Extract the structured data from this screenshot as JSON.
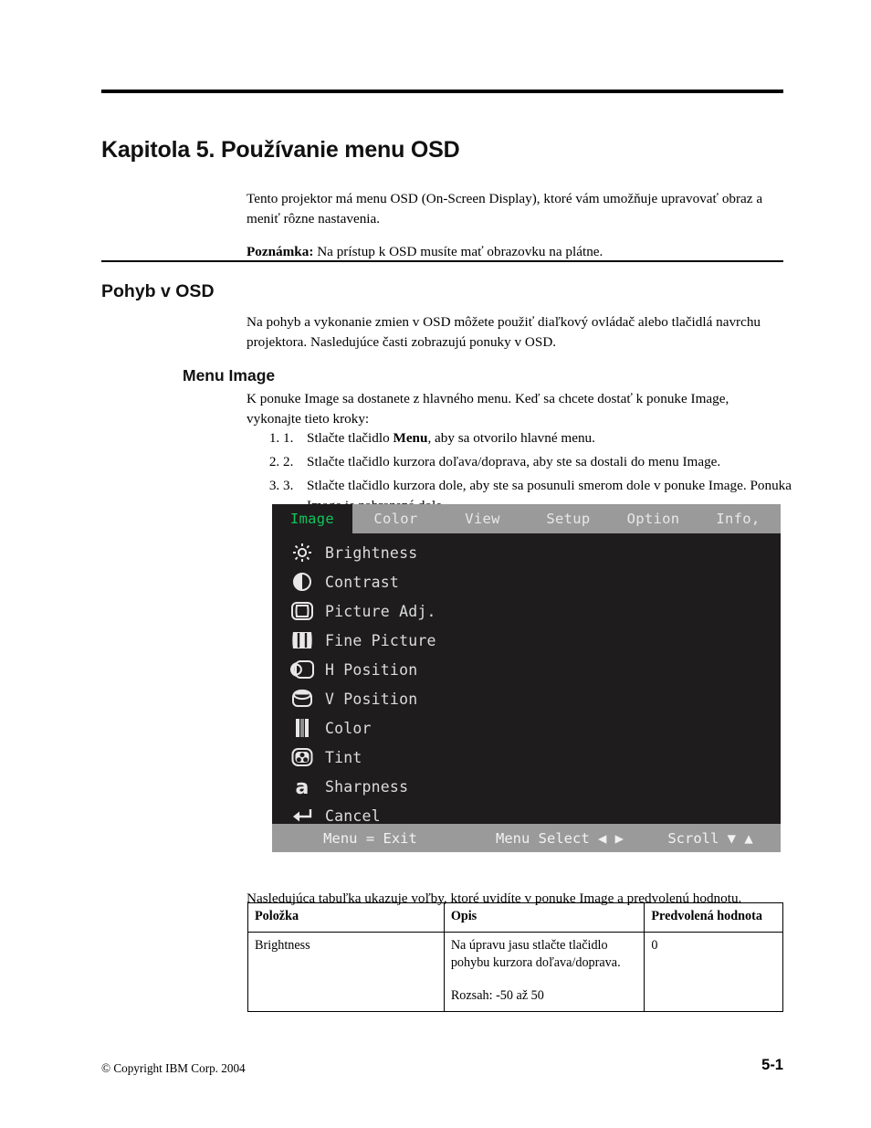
{
  "chapter": {
    "title": "Kapitola 5. Používanie menu OSD",
    "intro": "Tento projektor má menu OSD (On-Screen Display), ktoré vám umožňuje upravovať obraz a meniť rôzne nastavenia.",
    "note_label": "Poznámka:",
    "note_text": " Na prístup k OSD musíte mať obrazovku na plátne."
  },
  "section": {
    "heading": "Pohyb v OSD",
    "paragraph": "Na pohyb a vykonanie zmien v OSD môžete použiť diaľkový ovládač alebo tlačidlá navrchu projektora. Nasledujúce časti zobrazujú ponuky v OSD."
  },
  "subsection": {
    "heading": "Menu Image",
    "paragraph": "K ponuke Image sa dostanete z hlavného menu. Keď sa chcete dostať k ponuke Image, vykonajte tieto kroky:"
  },
  "steps": [
    {
      "num": "1.",
      "pre": "Stlačte tlačidlo ",
      "bold": "Menu",
      "post": ", aby sa otvorilo hlavné menu."
    },
    {
      "num": "2.",
      "pre": "Stlačte tlačidlo kurzora doľava/doprava, aby ste sa dostali do menu Image.",
      "bold": "",
      "post": ""
    },
    {
      "num": "3.",
      "pre": "Stlačte tlačidlo kurzora dole, aby ste sa posunuli smerom dole v ponuke Image. Ponuka Image je zobrazená dole.",
      "bold": "",
      "post": ""
    }
  ],
  "osd": {
    "colors": {
      "background": "#1e1c1d",
      "bar": "#9a9a9a",
      "active_tab_text": "#12c45a",
      "text": "#dcdcdc"
    },
    "tabs": [
      {
        "label": "Image",
        "active": true
      },
      {
        "label": "Color",
        "active": false
      },
      {
        "label": "View",
        "active": false
      },
      {
        "label": "Setup",
        "active": false
      },
      {
        "label": "Option",
        "active": false
      },
      {
        "label": "Info,",
        "active": false
      }
    ],
    "items": [
      {
        "label": "Brightness",
        "icon": "brightness-sun-icon"
      },
      {
        "label": "Contrast",
        "icon": "contrast-half-circle-icon"
      },
      {
        "label": "Picture Adj.",
        "icon": "picture-adjust-icon"
      },
      {
        "label": "Fine Picture",
        "icon": "fine-picture-bars-icon"
      },
      {
        "label": "H Position",
        "icon": "h-position-icon"
      },
      {
        "label": "V Position",
        "icon": "v-position-icon"
      },
      {
        "label": "Color",
        "icon": "color-bars-icon"
      },
      {
        "label": "Tint",
        "icon": "tint-icon"
      },
      {
        "label": "Sharpness",
        "icon": "sharpness-a-icon"
      },
      {
        "label": "Cancel",
        "icon": "cancel-return-arrow-icon"
      }
    ],
    "status": {
      "exit": "Menu = Exit",
      "select": "Menu Select ◀ ▶",
      "scroll": "Scroll ▼ ▲"
    }
  },
  "table": {
    "intro": "Nasledujúca tabuľka ukazuje voľby, ktoré uvidíte v ponuke Image a predvolenú hodnotu.",
    "headers": [
      "Položka",
      "Opis",
      "Predvolená hodnota"
    ],
    "rows": [
      {
        "item": "Brightness",
        "desc_1": "Na úpravu jasu stlačte tlačidlo pohybu kurzora doľava/doprava.",
        "desc_2": "Rozsah: -50 až 50",
        "default": "0"
      }
    ]
  },
  "footer": {
    "copyright": "© Copyright IBM Corp.  2004",
    "page": "5-1"
  }
}
